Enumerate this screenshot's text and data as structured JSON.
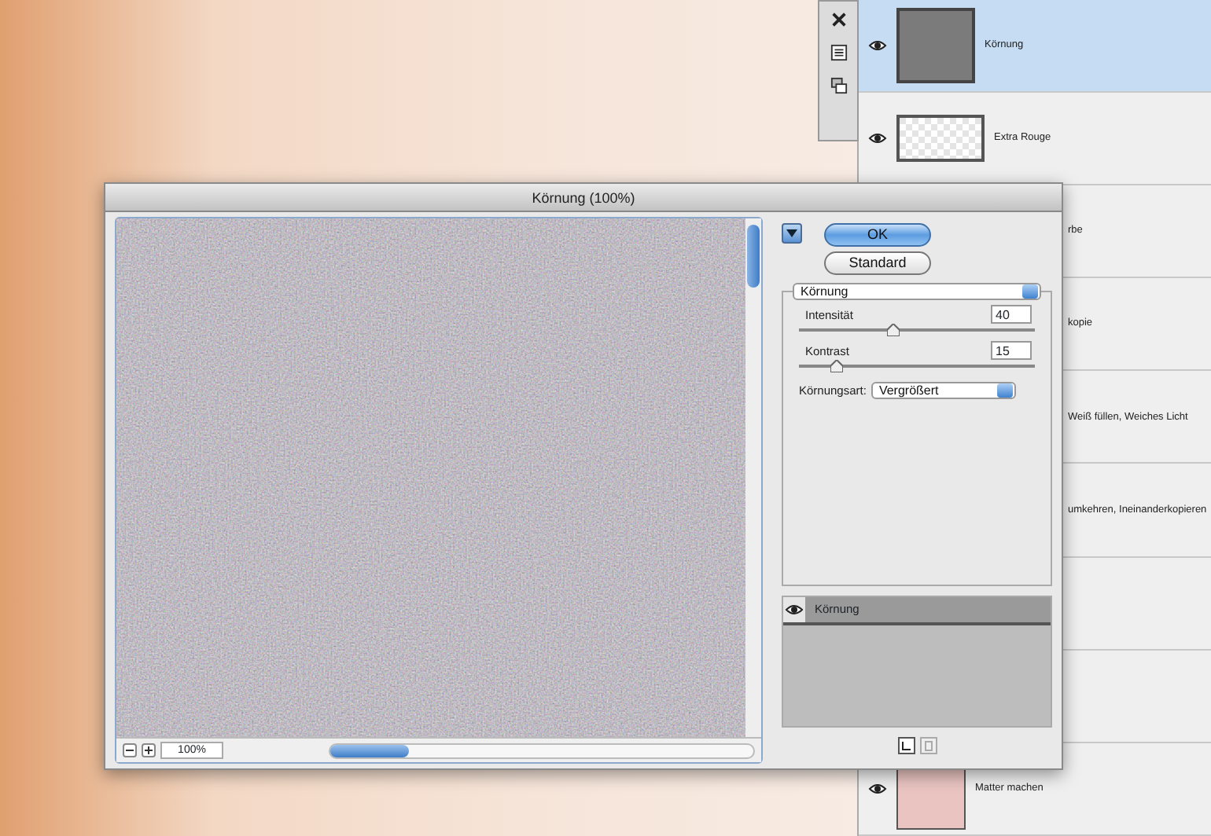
{
  "dialog": {
    "title": "Körnung (100%)",
    "zoom": "100%",
    "buttons": [
      {
        "label": "OK",
        "default": true
      },
      {
        "label": "Standard",
        "default": false
      }
    ],
    "filter_select": "Körnung",
    "params": [
      {
        "label": "Intensität",
        "value": "40",
        "level": 0.4
      },
      {
        "label": "Kontrast",
        "value": "15",
        "level": 0.16
      }
    ],
    "grain_type": {
      "label": "Körnungsart:",
      "value": "Vergrößert"
    },
    "effect_layers": [
      {
        "name": "Körnung",
        "selected": true
      }
    ]
  },
  "layers": [
    {
      "name": "Körnung",
      "selected": true,
      "kind": "gray"
    },
    {
      "name": "Extra Rouge",
      "selected": false,
      "kind": "transparent"
    },
    {
      "name": "rbe",
      "selected": false,
      "kind": "covered"
    },
    {
      "name": "kopie",
      "selected": false,
      "kind": "covered"
    },
    {
      "name": "Weiß füllen, Weiches Licht",
      "selected": false,
      "kind": "covered"
    },
    {
      "name": "umkehren, Ineinanderkopieren",
      "selected": false,
      "kind": "covered"
    },
    {
      "selected": false,
      "kind": "covered"
    },
    {
      "selected": false,
      "kind": "covered"
    },
    {
      "name": "Matter machen",
      "selected": false,
      "kind": "photo"
    }
  ]
}
